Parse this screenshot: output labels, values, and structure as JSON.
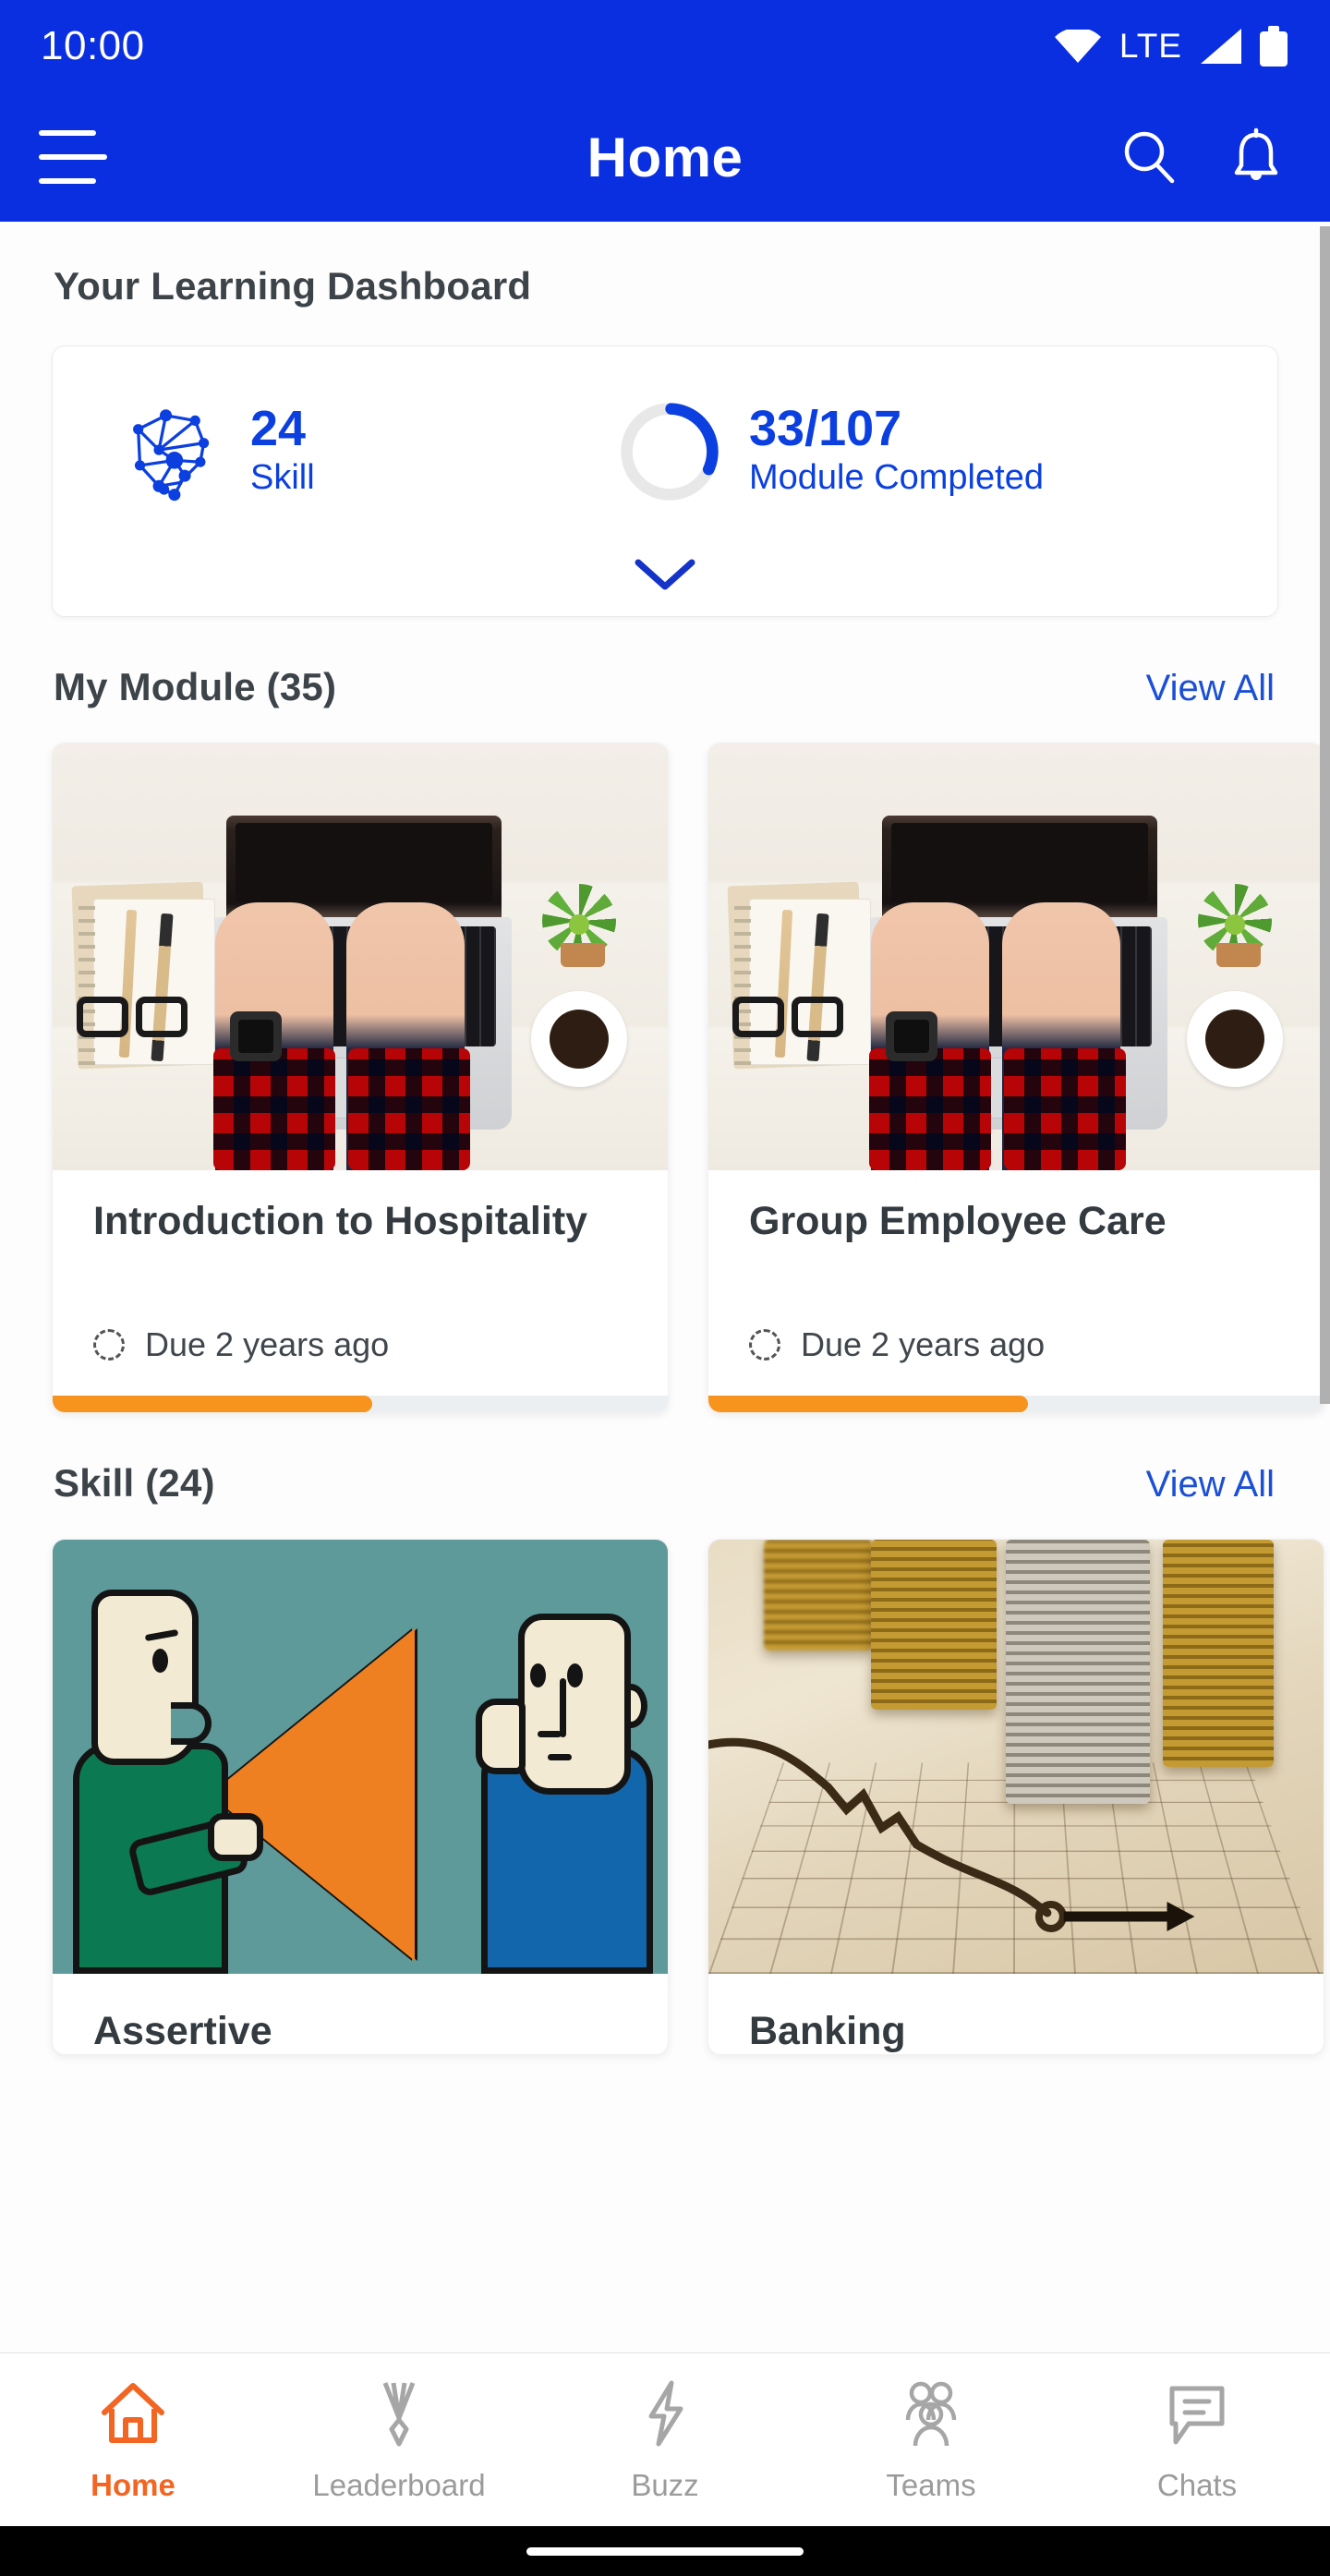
{
  "status_bar": {
    "time": "10:00",
    "network_label": "LTE",
    "icons": [
      "wifi-icon",
      "signal-icon",
      "battery-icon"
    ]
  },
  "app_bar": {
    "title": "Home",
    "menu_icon": "hamburger-menu-icon",
    "search_icon": "search-icon",
    "notification_icon": "bell-icon"
  },
  "dashboard": {
    "heading": "Your Learning Dashboard",
    "skill": {
      "value": "24",
      "label": "Skill",
      "icon": "skill-network-icon",
      "color": "#0b3fe0"
    },
    "module": {
      "value": "33/107",
      "label": "Module Completed",
      "completed": 33,
      "total": 107,
      "percent": 31,
      "ring_color": "#0b3fe0",
      "ring_track_color": "#e8e8e8"
    },
    "expand_icon": "chevron-down-icon"
  },
  "my_module": {
    "title": "My Module (35)",
    "count": 35,
    "view_all": "View All",
    "cards": [
      {
        "title": "Introduction to Hospitality",
        "due": "Due 2 years ago",
        "due_icon": "dashed-circle-icon",
        "progress_percent": 52,
        "progress_color": "#f7941e",
        "thumbnail": "desk-laptop-hands-photo"
      },
      {
        "title": "Group Employee Care",
        "due": "Due 2 years ago",
        "due_icon": "dashed-circle-icon",
        "progress_percent": 52,
        "progress_color": "#f7941e",
        "thumbnail": "desk-laptop-hands-photo"
      }
    ]
  },
  "skill_section": {
    "title": "Skill (24)",
    "count": 24,
    "view_all": "View All",
    "cards": [
      {
        "title": "Assertive",
        "thumbnail": "two-people-megaphone-illustration"
      },
      {
        "title": "Banking",
        "thumbnail": "coin-stacks-chart-photo"
      }
    ]
  },
  "bottom_nav": {
    "active": "Home",
    "items": [
      {
        "label": "Home",
        "icon": "home-icon"
      },
      {
        "label": "Leaderboard",
        "icon": "medal-icon"
      },
      {
        "label": "Buzz",
        "icon": "lightning-bolt-icon"
      },
      {
        "label": "Teams",
        "icon": "people-group-icon"
      },
      {
        "label": "Chats",
        "icon": "chat-bubble-icon"
      }
    ]
  },
  "theme": {
    "primary_blue": "#0a2fe0",
    "accent_orange": "#f26522",
    "progress_orange": "#f7941e",
    "link_blue": "#1a4fd6",
    "text_dark": "#333a40"
  }
}
